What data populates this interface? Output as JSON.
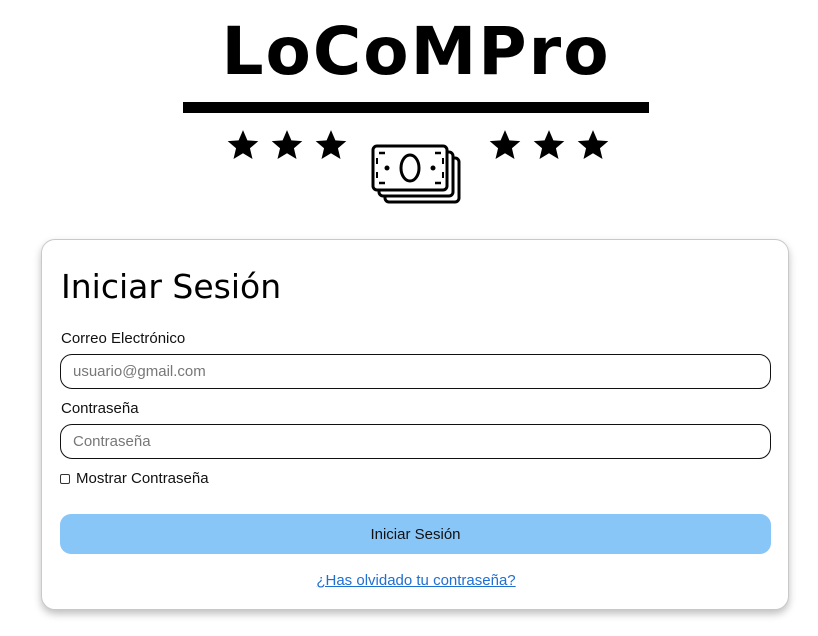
{
  "header": {
    "logo_text": "LoCoMPro",
    "stars_left_count": 3,
    "stars_right_count": 3,
    "center_icon": "money-stack-icon"
  },
  "login": {
    "title": "Iniciar Sesión",
    "email_label": "Correo Electrónico",
    "email_placeholder": "usuario@gmail.com",
    "email_value": "",
    "password_label": "Contraseña",
    "password_placeholder": "Contraseña",
    "password_value": "",
    "show_password_label": "Mostrar Contraseña",
    "show_password_checked": false,
    "submit_label": "Iniciar Sesión",
    "forgot_link": "¿Has olvidado tu contraseña?"
  },
  "colors": {
    "button_bg": "#89c6f8",
    "link": "#1f6fd1",
    "text": "#000000"
  }
}
